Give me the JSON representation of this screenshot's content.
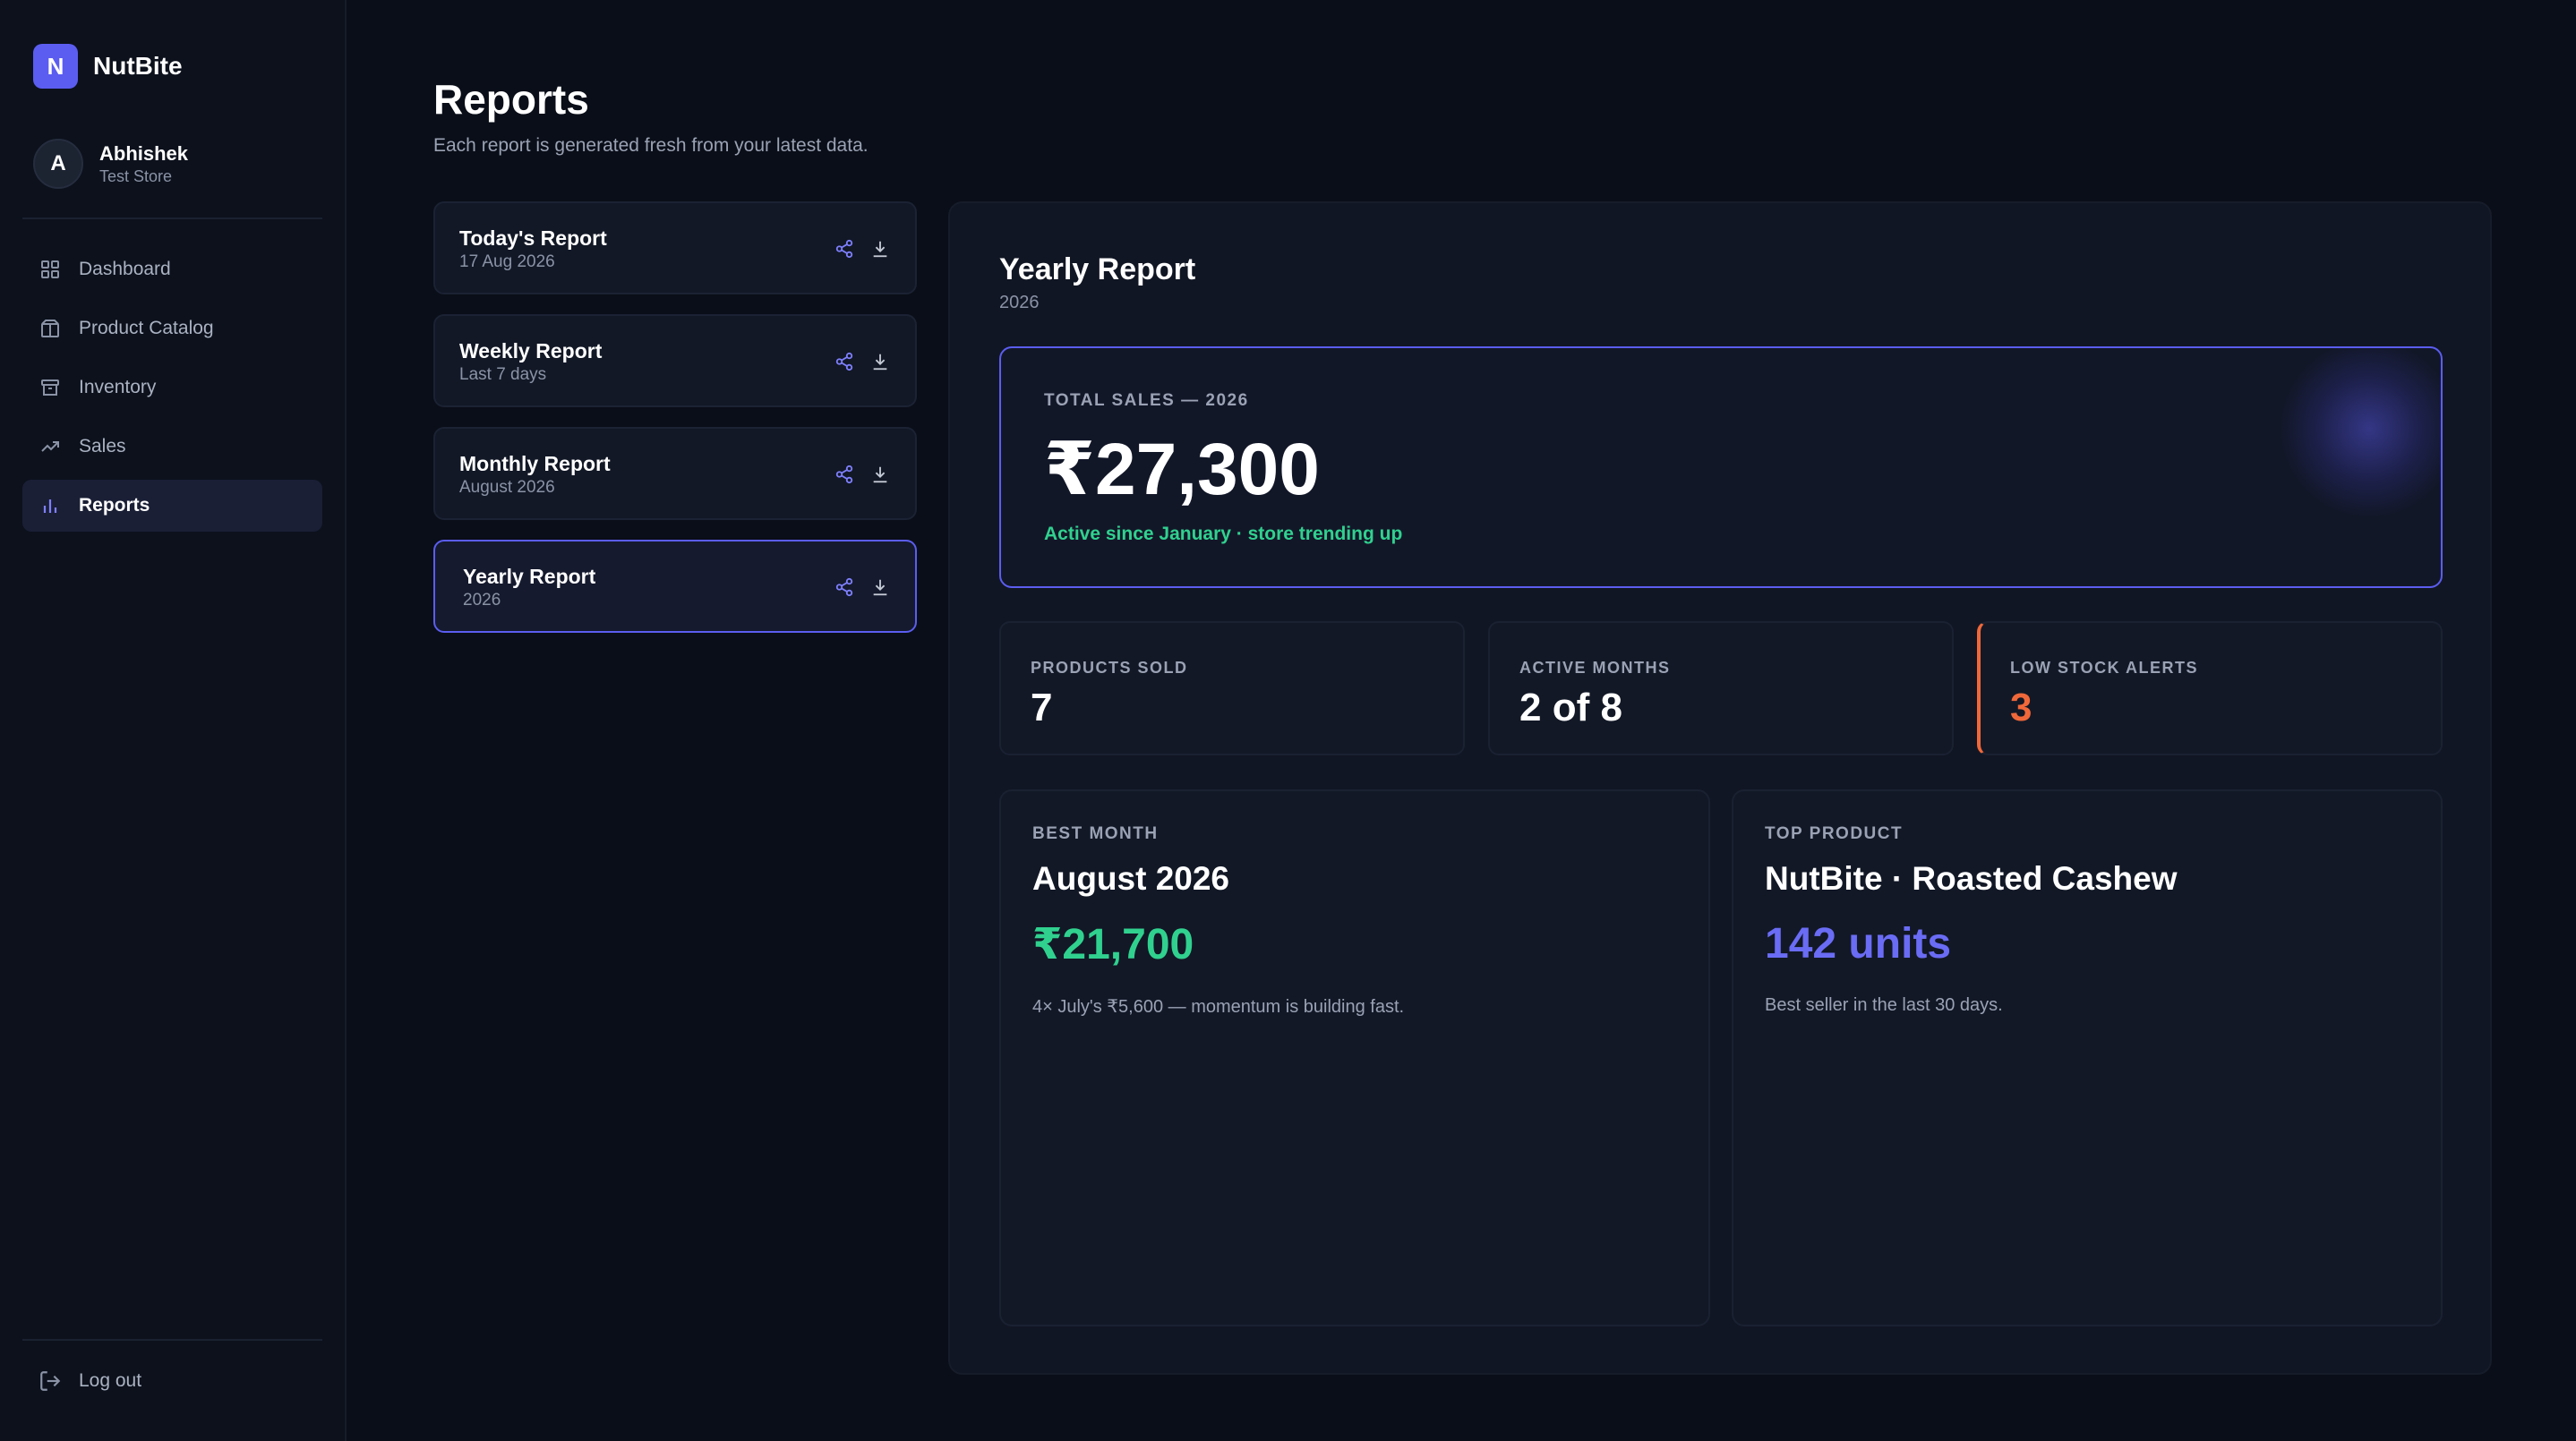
{
  "brand": {
    "logo_letter": "N",
    "name": "NutBite"
  },
  "user": {
    "initial": "A",
    "name": "Abhishek",
    "store": "Test Store"
  },
  "nav": [
    {
      "label": "Dashboard",
      "icon": "grid-icon"
    },
    {
      "label": "Product Catalog",
      "icon": "box-icon"
    },
    {
      "label": "Inventory",
      "icon": "archive-icon"
    },
    {
      "label": "Sales",
      "icon": "trending-up-icon"
    },
    {
      "label": "Reports",
      "icon": "bar-chart-icon",
      "active": true
    }
  ],
  "logout": {
    "label": "Log out"
  },
  "page": {
    "title": "Reports",
    "subtitle": "Each report is generated fresh from your latest data."
  },
  "reports": [
    {
      "title": "Today's Report",
      "subtitle": "17 Aug 2026"
    },
    {
      "title": "Weekly Report",
      "subtitle": "Last 7 days"
    },
    {
      "title": "Monthly Report",
      "subtitle": "August 2026"
    },
    {
      "title": "Yearly Report",
      "subtitle": "2026",
      "active": true
    }
  ],
  "panel": {
    "title": "Yearly Report",
    "subtitle": "2026",
    "total": {
      "label": "TOTAL SALES — 2026",
      "value": "₹27,300",
      "note": "Active since January · store trending up"
    },
    "stats": [
      {
        "label": "PRODUCTS SOLD",
        "value": "7"
      },
      {
        "label": "ACTIVE MONTHS",
        "value": "2 of 8"
      },
      {
        "label": "LOW STOCK ALERTS",
        "value": "3"
      }
    ],
    "best_month": {
      "label": "BEST MONTH",
      "title": "August 2026",
      "value": "₹21,700",
      "note": "4× July's ₹5,600 — momentum is building fast."
    },
    "top_product": {
      "label": "TOP PRODUCT",
      "title": "NutBite · Roasted Cashew",
      "value": "142 units",
      "note": "Best seller in the last 30 days."
    }
  },
  "colors": {
    "accent": "#5b5df0",
    "green": "#30d18f",
    "orange": "#f0683a",
    "background": "#0a0e18"
  }
}
